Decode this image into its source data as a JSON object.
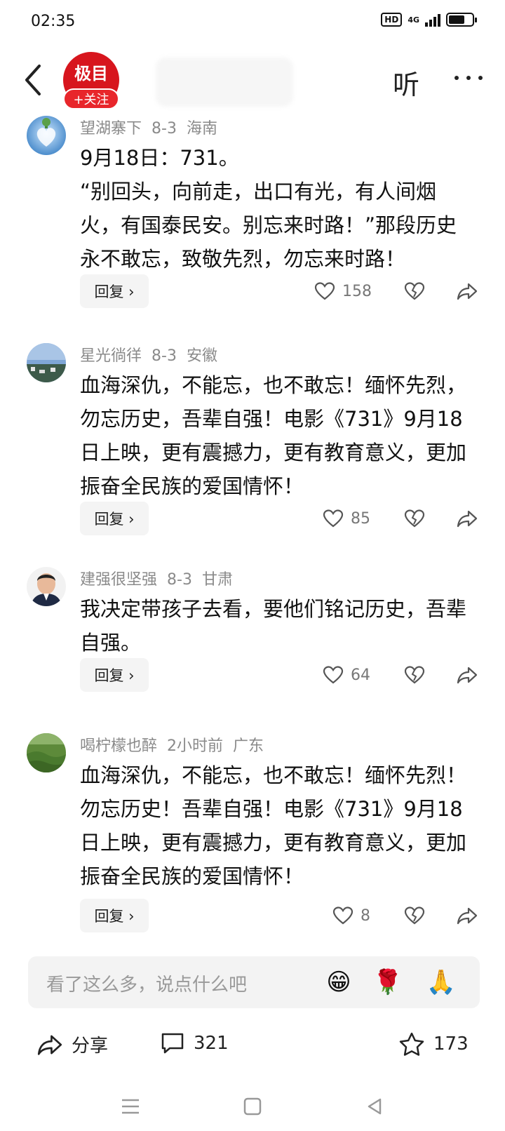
{
  "status_bar": {
    "time": "02:35",
    "hd_badge": "HD",
    "network": "4G",
    "battery_level": 0.6
  },
  "header": {
    "logo_text": "极目",
    "follow_label": "+关注",
    "listen_label": "听"
  },
  "comments": [
    {
      "username": "望湖寨下",
      "date": "8-3",
      "location": "海南",
      "text": "9月18日：731。\n“别回头，向前走，出口有光，有人间烟火，有国泰民安。别忘来时路！”那段历史永不敢忘，致敬先烈，勿忘来时路！",
      "reply_label": "回复 ›",
      "likes": "158"
    },
    {
      "username": "星光徜徉",
      "date": "8-3",
      "location": "安徽",
      "text": "血海深仇，不能忘，也不敢忘！缅怀先烈，勿忘历史，吾辈自强！电影《731》9月18日上映，更有震撼力，更有教育意义，更加振奋全民族的爱国情怀！",
      "reply_label": "回复 ›",
      "likes": "85"
    },
    {
      "username": "建强很坚强",
      "date": "8-3",
      "location": "甘肃",
      "text": "我决定带孩子去看，要他们铭记历史，吾辈自强。",
      "reply_label": "回复 ›",
      "likes": "64"
    },
    {
      "username": "喝柠檬也醉",
      "date": "2小时前",
      "location": "广东",
      "text": "血海深仇，不能忘，也不敢忘！缅怀先烈！勿忘历史！吾辈自强！电影《731》9月18日上映，更有震撼力，更有教育意义，更加振奋全民族的爱国情怀！",
      "reply_label": "回复 ›",
      "likes": "8"
    }
  ],
  "comment_input": {
    "placeholder": "看了这么多，说点什么吧",
    "emojis": [
      "😁",
      "🌹",
      "🙏"
    ]
  },
  "action_bar": {
    "share_label": "分享",
    "comments_count": "321",
    "favorites_count": "173"
  },
  "colors": {
    "brand_red": "#d7151d",
    "meta_gray": "#8a8a8a",
    "icon_gray": "#777777"
  }
}
